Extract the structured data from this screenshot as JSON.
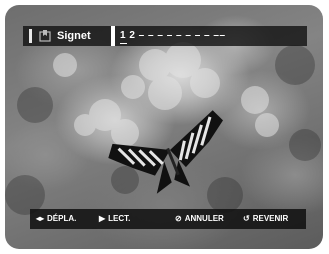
{
  "header": {
    "title": "Signet",
    "bookmarks": "1 2 – – – – – – – – ––"
  },
  "footer": {
    "move": {
      "icon": "left-right-arrows-icon",
      "glyph": "◂▸",
      "label": "DÉPLA."
    },
    "play": {
      "icon": "play-icon",
      "glyph": "▶",
      "label": "LECT."
    },
    "cancel": {
      "icon": "cancel-icon",
      "glyph": "⊘",
      "label": "ANNULER"
    },
    "back": {
      "icon": "return-icon",
      "glyph": "↺",
      "label": "REVENIR"
    }
  },
  "colors": {
    "bar_bg": "#141414",
    "text": "#ffffff"
  }
}
